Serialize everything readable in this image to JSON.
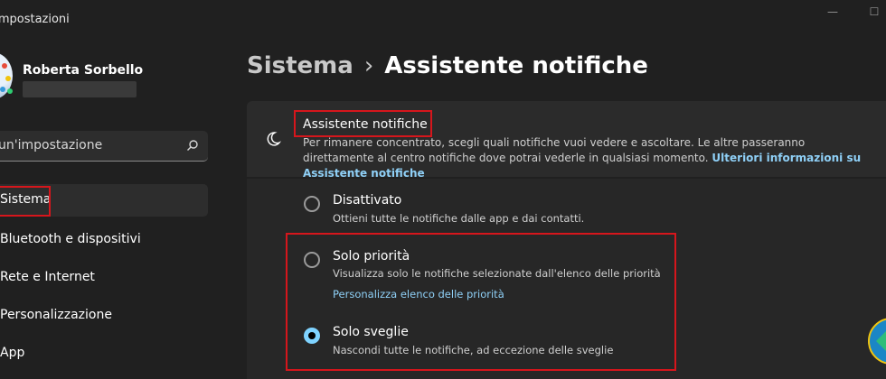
{
  "window": {
    "title": "Impostazioni"
  },
  "user": {
    "name": "Roberta Sorbello"
  },
  "search": {
    "placeholder": "un'impostazione"
  },
  "sidebar": {
    "items": [
      {
        "label": "Sistema",
        "active": true
      },
      {
        "label": "Bluetooth e dispositivi"
      },
      {
        "label": "Rete e Internet"
      },
      {
        "label": "Personalizzazione"
      },
      {
        "label": "App"
      }
    ]
  },
  "breadcrumb": {
    "parent": "Sistema",
    "separator": "›",
    "current": "Assistente notifiche"
  },
  "focus_assist": {
    "heading": "Assistente notifiche",
    "description": "Per rimanere concentrato, scegli quali notifiche vuoi vedere e ascoltare. Le altre passeranno direttamente al centro notifiche dove potrai vederle in qualsiasi momento.",
    "learn_more": "Ulteriori informazioni su Assistente notifiche",
    "options": [
      {
        "title": "Disattivato",
        "subtitle": "Ottieni tutte le notifiche dalle app e dai contatti.",
        "selected": false
      },
      {
        "title": "Solo priorità",
        "subtitle": "Visualizza solo le notifiche selezionate dall'elenco delle priorità",
        "link": "Personalizza elenco delle priorità",
        "selected": false
      },
      {
        "title": "Solo sveglie",
        "subtitle": "Nascondi tutte le notifiche, ad eccezione delle sveglie",
        "selected": true
      }
    ]
  },
  "colors": {
    "accent": "#7fd3ff",
    "link": "#8fd0f7",
    "highlight": "#d6161c",
    "background": "#202020"
  }
}
